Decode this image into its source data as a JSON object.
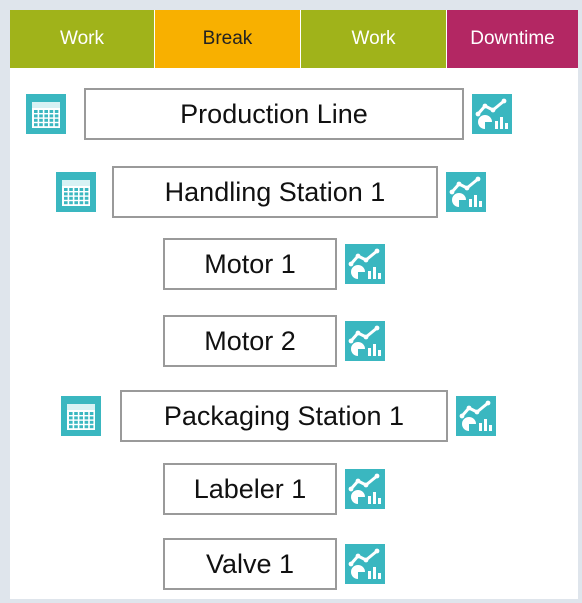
{
  "tabs": [
    {
      "label": "Work",
      "bg": "#a0b31a",
      "fg": "#ffffff"
    },
    {
      "label": "Break",
      "bg": "#f8b000",
      "fg": "#222222"
    },
    {
      "label": "Work",
      "bg": "#a0b31a",
      "fg": "#ffffff"
    },
    {
      "label": "Downtime",
      "bg": "#b32763",
      "fg": "#ffffff"
    }
  ],
  "nodes": [
    {
      "label": "Production Line",
      "calendar": true,
      "calendar_icon": "calendar-icon",
      "chart_icon": "analytics-chart-icon"
    },
    {
      "label": "Handling Station 1",
      "calendar": true,
      "calendar_icon": "calendar-icon",
      "chart_icon": "analytics-chart-icon"
    },
    {
      "label": "Motor 1",
      "calendar": false,
      "chart_icon": "analytics-chart-icon"
    },
    {
      "label": "Motor 2",
      "calendar": false,
      "chart_icon": "analytics-chart-icon"
    },
    {
      "label": "Packaging Station 1",
      "calendar": true,
      "calendar_icon": "calendar-icon",
      "chart_icon": "analytics-chart-icon"
    },
    {
      "label": "Labeler 1",
      "calendar": false,
      "chart_icon": "analytics-chart-icon"
    },
    {
      "label": "Valve 1",
      "calendar": false,
      "chart_icon": "analytics-chart-icon"
    }
  ],
  "colors": {
    "icon_teal": "#3ab7c0",
    "frame": "#dfe5ec",
    "box_border": "#9a9a9a"
  }
}
